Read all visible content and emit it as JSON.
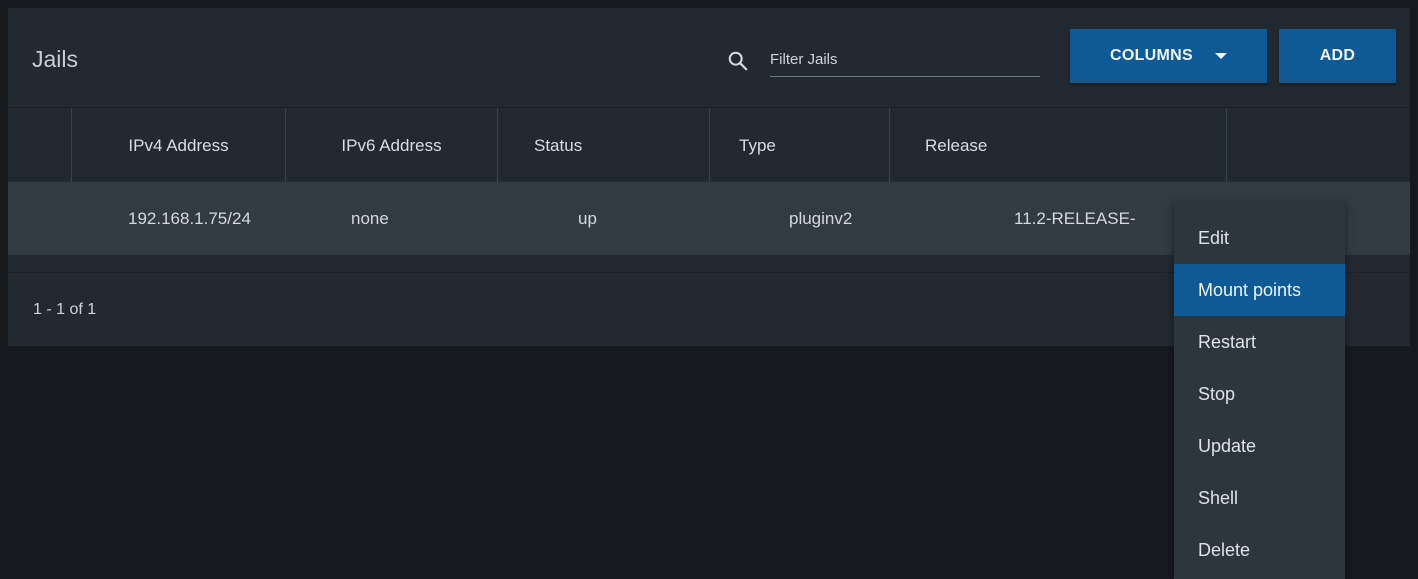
{
  "header": {
    "title": "Jails",
    "search_placeholder": "Filter Jails",
    "columns_label": "COLUMNS",
    "add_label": "ADD"
  },
  "table": {
    "columns": [
      "IPv4 Address",
      "IPv6 Address",
      "Status",
      "Type",
      "Release"
    ],
    "rows": [
      [
        "192.168.1.75/24",
        "none",
        "up",
        "pluginv2",
        "11.2-RELEASE-"
      ]
    ]
  },
  "footer": {
    "range": "1 - 1 of 1"
  },
  "menu": {
    "items": [
      "Edit",
      "Mount points",
      "Restart",
      "Stop",
      "Update",
      "Shell",
      "Delete"
    ],
    "active": "Mount points"
  },
  "colors": {
    "accent": "#0d5a96",
    "panel": "#222930",
    "row": "#323a42",
    "menu": "#2e363d",
    "page": "#15191e"
  }
}
